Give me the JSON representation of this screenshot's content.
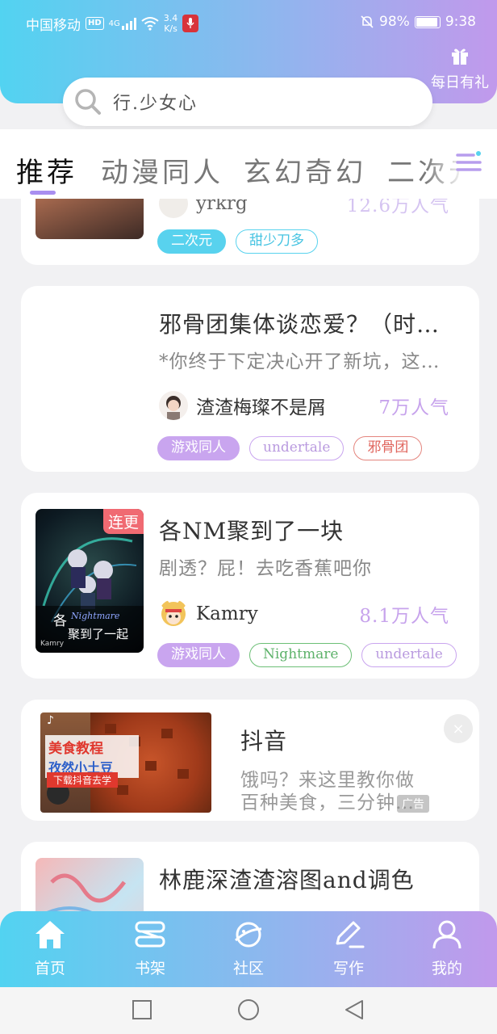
{
  "status_bar": {
    "carrier": "中国移动",
    "hd": "HD",
    "net": "4G",
    "speed_value": "3.4",
    "speed_unit": "K/s",
    "battery": "98%",
    "time": "9:38",
    "battery_level": 0.98
  },
  "header": {
    "gift_label": "每日有礼",
    "search_text": "行.少女心"
  },
  "tabs": [
    {
      "label": "推荐",
      "active": true
    },
    {
      "label": "动漫同人",
      "active": false
    },
    {
      "label": "玄幻奇幻",
      "active": false
    },
    {
      "label": "二次元",
      "active": false
    }
  ],
  "cards": [
    {
      "title": "",
      "author": "yrkrg",
      "popularity": "12.6万人气",
      "tags": [
        "二次元",
        "甜少刀多"
      ]
    },
    {
      "title": "邪骨团集体谈恋爱？（时…",
      "desc": "*你终于下定决心开了新坑，这…",
      "author": "渣渣梅璨不是屑",
      "popularity": "7万人气",
      "tags": [
        "游戏同人",
        "undertale",
        "邪骨团"
      ]
    },
    {
      "title": "各NM聚到了一块",
      "desc": "剧透？屁！去吃香蕉吧你",
      "author": "Kamry",
      "popularity": "8.1万人气",
      "badge": "连更",
      "cover_text_1": "各",
      "cover_text_2": "Nightmare",
      "cover_text_3": "聚到了一起",
      "cover_credit": "Kamry",
      "tags": [
        "游戏同人",
        "Nightmare",
        "undertale"
      ]
    },
    {
      "title": "林鹿深渣渣溶图and调色",
      "desc": ""
    }
  ],
  "ad": {
    "title": "抖音",
    "desc_line1": "饿吗？来这里教你做",
    "desc_line2": "百种美食，三分钟…",
    "badge": "广告",
    "close": "×",
    "img_text_1": "美食教程",
    "img_text_2": "孜然小土豆",
    "img_text_3": "下载抖音去学"
  },
  "bottom_nav": [
    {
      "label": "首页",
      "icon": "home-icon"
    },
    {
      "label": "书架",
      "icon": "bookshelf-icon"
    },
    {
      "label": "社区",
      "icon": "planet-icon"
    },
    {
      "label": "写作",
      "icon": "pen-icon"
    },
    {
      "label": "我的",
      "icon": "user-icon"
    }
  ],
  "colors": {
    "gradient_start": "#52d3f1",
    "gradient_end": "#c199ec",
    "tag_purple": "#c9a5ef",
    "tag_cyan": "#58d2ee",
    "popularity": "#c7a3ec",
    "badge_red": "#f06a72"
  }
}
